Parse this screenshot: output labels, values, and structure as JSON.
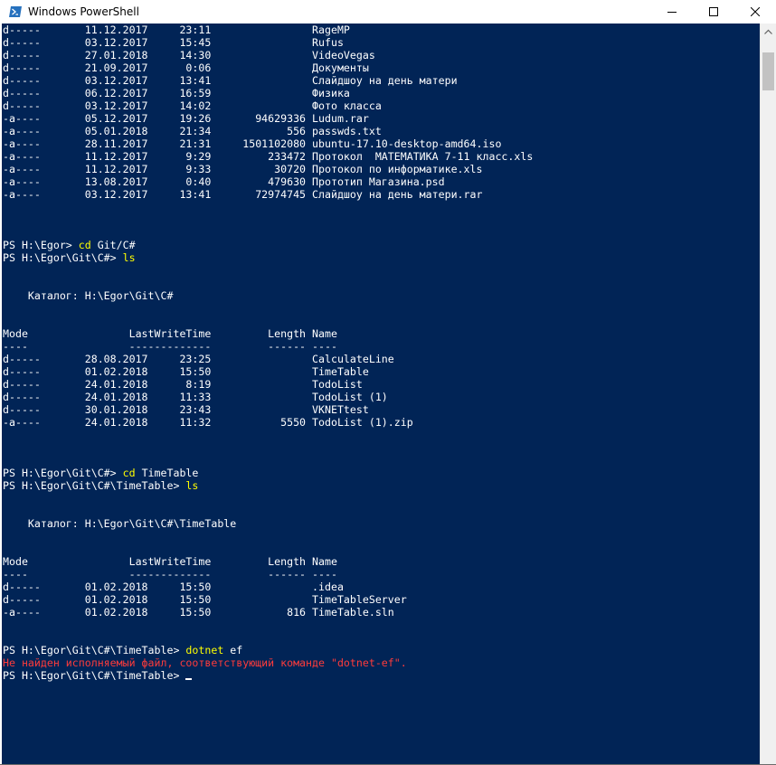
{
  "window": {
    "title": "Windows PowerShell"
  },
  "colors": {
    "console_bg": "#012456",
    "text": "#ffffff",
    "command": "#ffff00",
    "error": "#ff3b3b"
  },
  "console": {
    "lines": [
      {
        "text": "d-----       11.12.2017     23:11                RageMP"
      },
      {
        "text": "d-----       03.12.2017     15:45                Rufus"
      },
      {
        "text": "d-----       27.01.2018     14:30                VideoVegas"
      },
      {
        "text": "d-----       21.09.2017      0:06                Документы"
      },
      {
        "text": "d-----       03.12.2017     13:41                Слайдшоу на день матери"
      },
      {
        "text": "d-----       06.12.2017     16:59                Физика"
      },
      {
        "text": "d-----       03.12.2017     14:02                Фото класса"
      },
      {
        "text": "-a----       05.12.2017     19:26       94629336 Ludum.rar"
      },
      {
        "text": "-a----       05.01.2018     21:34            556 passwds.txt"
      },
      {
        "text": "-a----       28.11.2017     21:31     1501102080 ubuntu-17.10-desktop-amd64.iso"
      },
      {
        "text": "-a----       11.12.2017      9:29         233472 Протокол  МАТЕМАТИКА 7-11 класс.xls"
      },
      {
        "text": "-a----       11.12.2017      9:33          30720 Протокол по информатике.xls"
      },
      {
        "text": "-a----       13.08.2017      0:40         479630 Прототип Магазина.psd"
      },
      {
        "text": "-a----       03.12.2017     13:41       72974745 Слайдшоу на день матери.rar"
      },
      {
        "text": ""
      },
      {
        "text": ""
      },
      {
        "text": ""
      },
      {
        "prompt": "PS H:\\Egor> ",
        "cmd": "cd",
        "arg": " Git/C#"
      },
      {
        "prompt": "PS H:\\Egor\\Git\\C#> ",
        "cmd": "ls",
        "arg": ""
      },
      {
        "text": ""
      },
      {
        "text": ""
      },
      {
        "text": "    Каталог: H:\\Egor\\Git\\C#"
      },
      {
        "text": ""
      },
      {
        "text": ""
      },
      {
        "text": "Mode                LastWriteTime         Length Name"
      },
      {
        "text": "----                -------------         ------ ----"
      },
      {
        "text": "d-----       28.08.2017     23:25                CalculateLine"
      },
      {
        "text": "d-----       01.02.2018     15:50                TimeTable"
      },
      {
        "text": "d-----       24.01.2018      8:19                TodoList"
      },
      {
        "text": "d-----       24.01.2018     11:33                TodoList (1)"
      },
      {
        "text": "d-----       30.01.2018     23:43                VKNETtest"
      },
      {
        "text": "-a----       24.01.2018     11:32           5550 TodoList (1).zip"
      },
      {
        "text": ""
      },
      {
        "text": ""
      },
      {
        "text": ""
      },
      {
        "prompt": "PS H:\\Egor\\Git\\C#> ",
        "cmd": "cd",
        "arg": " TimeTable"
      },
      {
        "prompt": "PS H:\\Egor\\Git\\C#\\TimeTable> ",
        "cmd": "ls",
        "arg": ""
      },
      {
        "text": ""
      },
      {
        "text": ""
      },
      {
        "text": "    Каталог: H:\\Egor\\Git\\C#\\TimeTable"
      },
      {
        "text": ""
      },
      {
        "text": ""
      },
      {
        "text": "Mode                LastWriteTime         Length Name"
      },
      {
        "text": "----                -------------         ------ ----"
      },
      {
        "text": "d-----       01.02.2018     15:50                .idea"
      },
      {
        "text": "d-----       01.02.2018     15:50                TimeTableServer"
      },
      {
        "text": "-a----       01.02.2018     15:50            816 TimeTable.sln"
      },
      {
        "text": ""
      },
      {
        "text": ""
      },
      {
        "prompt": "PS H:\\Egor\\Git\\C#\\TimeTable> ",
        "cmd": "dotnet",
        "arg": " ef"
      },
      {
        "text": "Не найден исполняемый файл, соответствующий команде \"dotnet-ef\".",
        "error": true
      },
      {
        "prompt": "PS H:\\Egor\\Git\\C#\\TimeTable> ",
        "cmd": "",
        "arg": "",
        "cursor": true
      }
    ]
  }
}
